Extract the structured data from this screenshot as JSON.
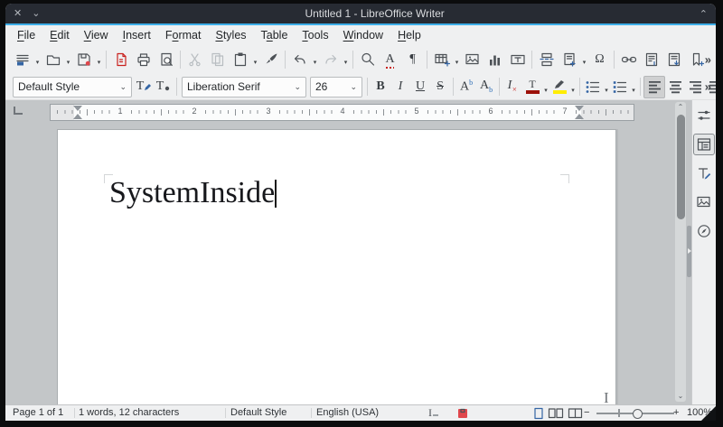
{
  "window": {
    "title": "Untitled 1 - LibreOffice Writer"
  },
  "menubar": {
    "items": [
      {
        "pre": "",
        "u": "F",
        "post": "ile"
      },
      {
        "pre": "",
        "u": "E",
        "post": "dit"
      },
      {
        "pre": "",
        "u": "V",
        "post": "iew"
      },
      {
        "pre": "",
        "u": "I",
        "post": "nsert"
      },
      {
        "pre": "F",
        "u": "o",
        "post": "rmat"
      },
      {
        "pre": "",
        "u": "S",
        "post": "tyles"
      },
      {
        "pre": "T",
        "u": "a",
        "post": "ble"
      },
      {
        "pre": "",
        "u": "T",
        "post": "ools"
      },
      {
        "pre": "",
        "u": "W",
        "post": "indow"
      },
      {
        "pre": "",
        "u": "H",
        "post": "elp"
      }
    ]
  },
  "icons": {
    "close": "✕",
    "chevron_down": "⌄",
    "chevron_up": "⌃",
    "dropdown": "▾",
    "combo_arrow": "⌄",
    "overflow": "»",
    "pilcrow": "¶",
    "omega": "Ω",
    "bold": "B",
    "italic": "I",
    "underline": "U",
    "strikethrough": "S",
    "letter_A": "A",
    "letter_T": "T",
    "script_mark": "b",
    "clear_base": "I",
    "clear_mark": "×",
    "selection_mode": "I",
    "zoom_out": "−",
    "zoom_in": "+",
    "ibeam": "I",
    "scroll_up": "⌃",
    "scroll_down": "⌄"
  },
  "formatting": {
    "paragraph_style": "Default Style",
    "font_name": "Liberation Serif",
    "font_size": "26"
  },
  "ruler": {
    "numbers": [
      "1",
      "2",
      "3",
      "4",
      "5",
      "6",
      "7"
    ]
  },
  "document": {
    "text": "SystemInside"
  },
  "statusbar": {
    "page": "Page 1 of 1",
    "words": "1 words, 12 characters",
    "style": "Default Style",
    "language": "English (USA)",
    "zoom": "100%"
  },
  "colors": {
    "accent": "#3daee9",
    "titlebar": "#272b33",
    "font_color_bar": "#9c1009",
    "highlight_bar": "#ffed00",
    "modified_flag": "#e0474c",
    "active_layout_icon": "#2a6bb5"
  }
}
